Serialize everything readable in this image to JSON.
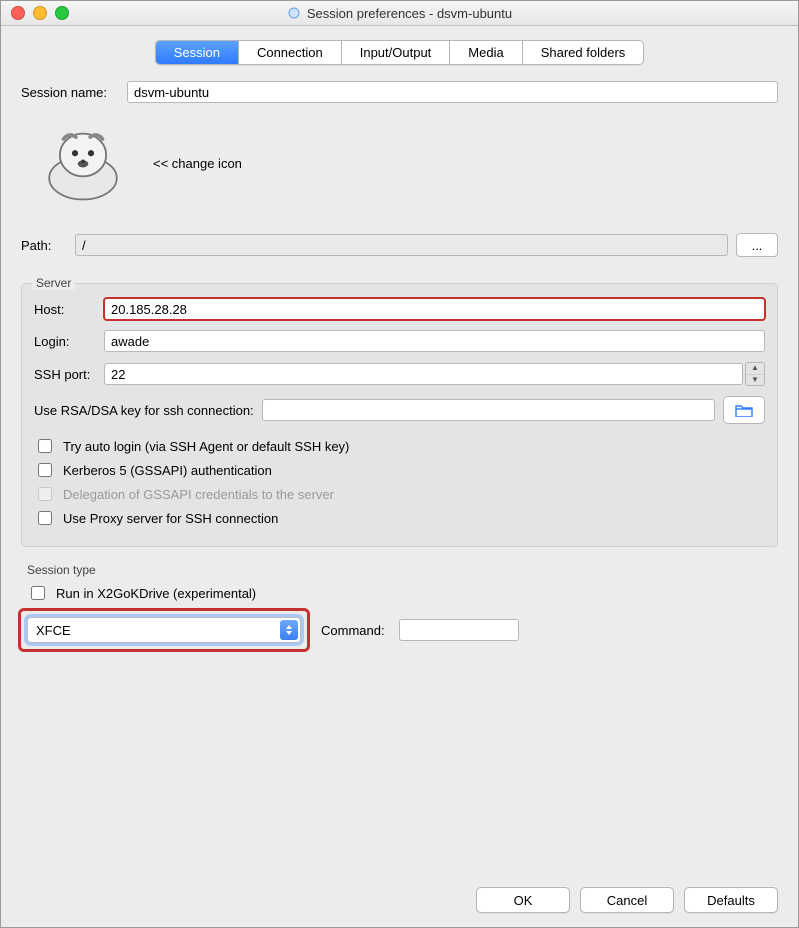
{
  "window": {
    "title": "Session preferences - dsvm-ubuntu"
  },
  "tabs": {
    "session": "Session",
    "connection": "Connection",
    "input_output": "Input/Output",
    "media": "Media",
    "shared_folders": "Shared folders"
  },
  "session_name": {
    "label": "Session name:",
    "value": "dsvm-ubuntu"
  },
  "change_icon": "<< change icon",
  "path": {
    "label": "Path:",
    "value": "/",
    "browse_label": "..."
  },
  "server": {
    "legend": "Server",
    "host_label": "Host:",
    "host_value": "20.185.28.28",
    "login_label": "Login:",
    "login_value": "awade",
    "ssh_port_label": "SSH port:",
    "ssh_port_value": "22",
    "rsa_label": "Use RSA/DSA key for ssh connection:",
    "rsa_value": "",
    "check_auto_login": "Try auto login (via SSH Agent or default SSH key)",
    "check_kerberos": "Kerberos 5 (GSSAPI) authentication",
    "check_delegation": "Delegation of GSSAPI credentials to the server",
    "check_proxy": "Use Proxy server for SSH connection"
  },
  "session_type": {
    "legend": "Session type",
    "run_x2go": "Run in X2GoKDrive (experimental)",
    "combo_value": "XFCE",
    "command_label": "Command:",
    "command_value": ""
  },
  "footer": {
    "ok": "OK",
    "cancel": "Cancel",
    "defaults": "Defaults"
  }
}
